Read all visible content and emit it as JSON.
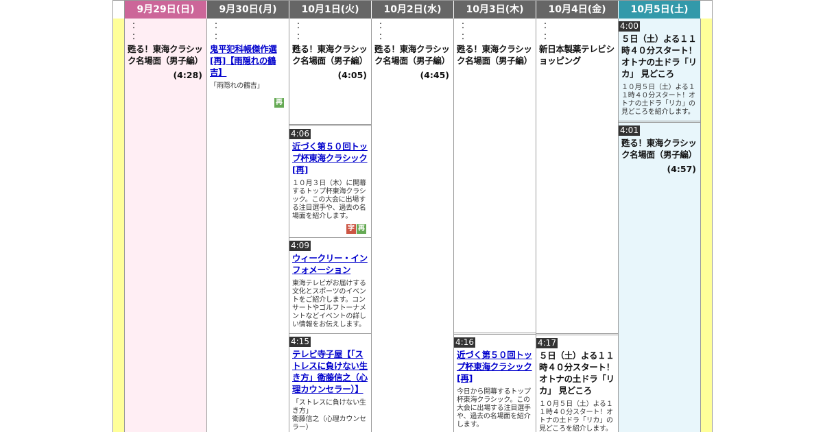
{
  "days": [
    {
      "label": "9月29日(日)",
      "type": "sun"
    },
    {
      "label": "9月30日(月)",
      "type": "wk"
    },
    {
      "label": "10月1日(火)",
      "type": "wk"
    },
    {
      "label": "10月2日(水)",
      "type": "wk"
    },
    {
      "label": "10月3日(木)",
      "type": "wk"
    },
    {
      "label": "10月4日(金)",
      "type": "wk"
    },
    {
      "label": "10月5日(土)",
      "type": "sat"
    }
  ],
  "dots": "：",
  "sun": {
    "p1_title": "甦る！東海クラシック名場面（男子編）",
    "p1_dur": "(4:28)"
  },
  "mon": {
    "p1_title": "鬼平犯科帳傑作選[再]【雨隠れの鶴吉】",
    "p1_desc": "「雨隠れの鶴吉」",
    "p1_badge": "再"
  },
  "tue": {
    "p1_title": "甦る！東海クラシック名場面（男子編）",
    "p1_dur": "(4:05)",
    "p2_time": "4:06",
    "p2_title": "近づく第５０回トップ杯東海クラシック[再]",
    "p2_desc": "１０月３日（木）に開幕するトップ杯東海クラシック。この大会に出場する注目選手や、過去の名場面を紹介します。",
    "p2_badge1": "字",
    "p2_badge2": "再",
    "p3_time": "4:09",
    "p3_title": "ウィークリー・インフォメーション",
    "p3_desc": "東海テレビがお届けする文化とスポーツのイベントをご紹介します。コンサートやゴルフトーナメントなどイベントの詳しい情報をお伝えします。",
    "p4_time": "4:15",
    "p4_title": "テレビ寺子屋【「ストレスに負けない生き方」衛藤信之（心理カウンセラー）】",
    "p4_desc": "「ストレスに負けない生き方」\n衛藤信之（心理カウンセラー）"
  },
  "wed": {
    "p1_title": "甦る！東海クラシック名場面（男子編）",
    "p1_dur": "(4:45)"
  },
  "thu": {
    "p1_title": "甦る！東海クラシック名場面（男子編）",
    "p2_time": "4:16",
    "p2_title": "近づく第５０回トップ杯東海クラシック[再]",
    "p2_desc": "今日から開幕するトップ杯東海クラシック。この大会に出場する注目選手や、過去の名場面を紹介します。"
  },
  "fri": {
    "p1_title": "新日本製薬テレビショッピング",
    "p2_time": "4:17",
    "p2_title": "５日（土）よる１１時４０分スタート！オトナの土ドラ「リカ」 見どころ",
    "p2_desc": "１０月５日（土）よる１１時４０分スタート！オトナの土ドラ「リカ」の見どころを紹介します。"
  },
  "sat": {
    "p1_time": "4:00",
    "p1_title": "５日（土）よる１１時４０分スタート！オトナの土ドラ「リカ」 見どころ",
    "p1_desc": "１０月５日（土）よる１１時４０分スタート！オトナの土ドラ「リカ」の見どころを紹介します。",
    "p2_time": "4:01",
    "p2_title": "甦る！東海クラシック名場面（男子編）",
    "p2_dur": "(4:57)"
  }
}
